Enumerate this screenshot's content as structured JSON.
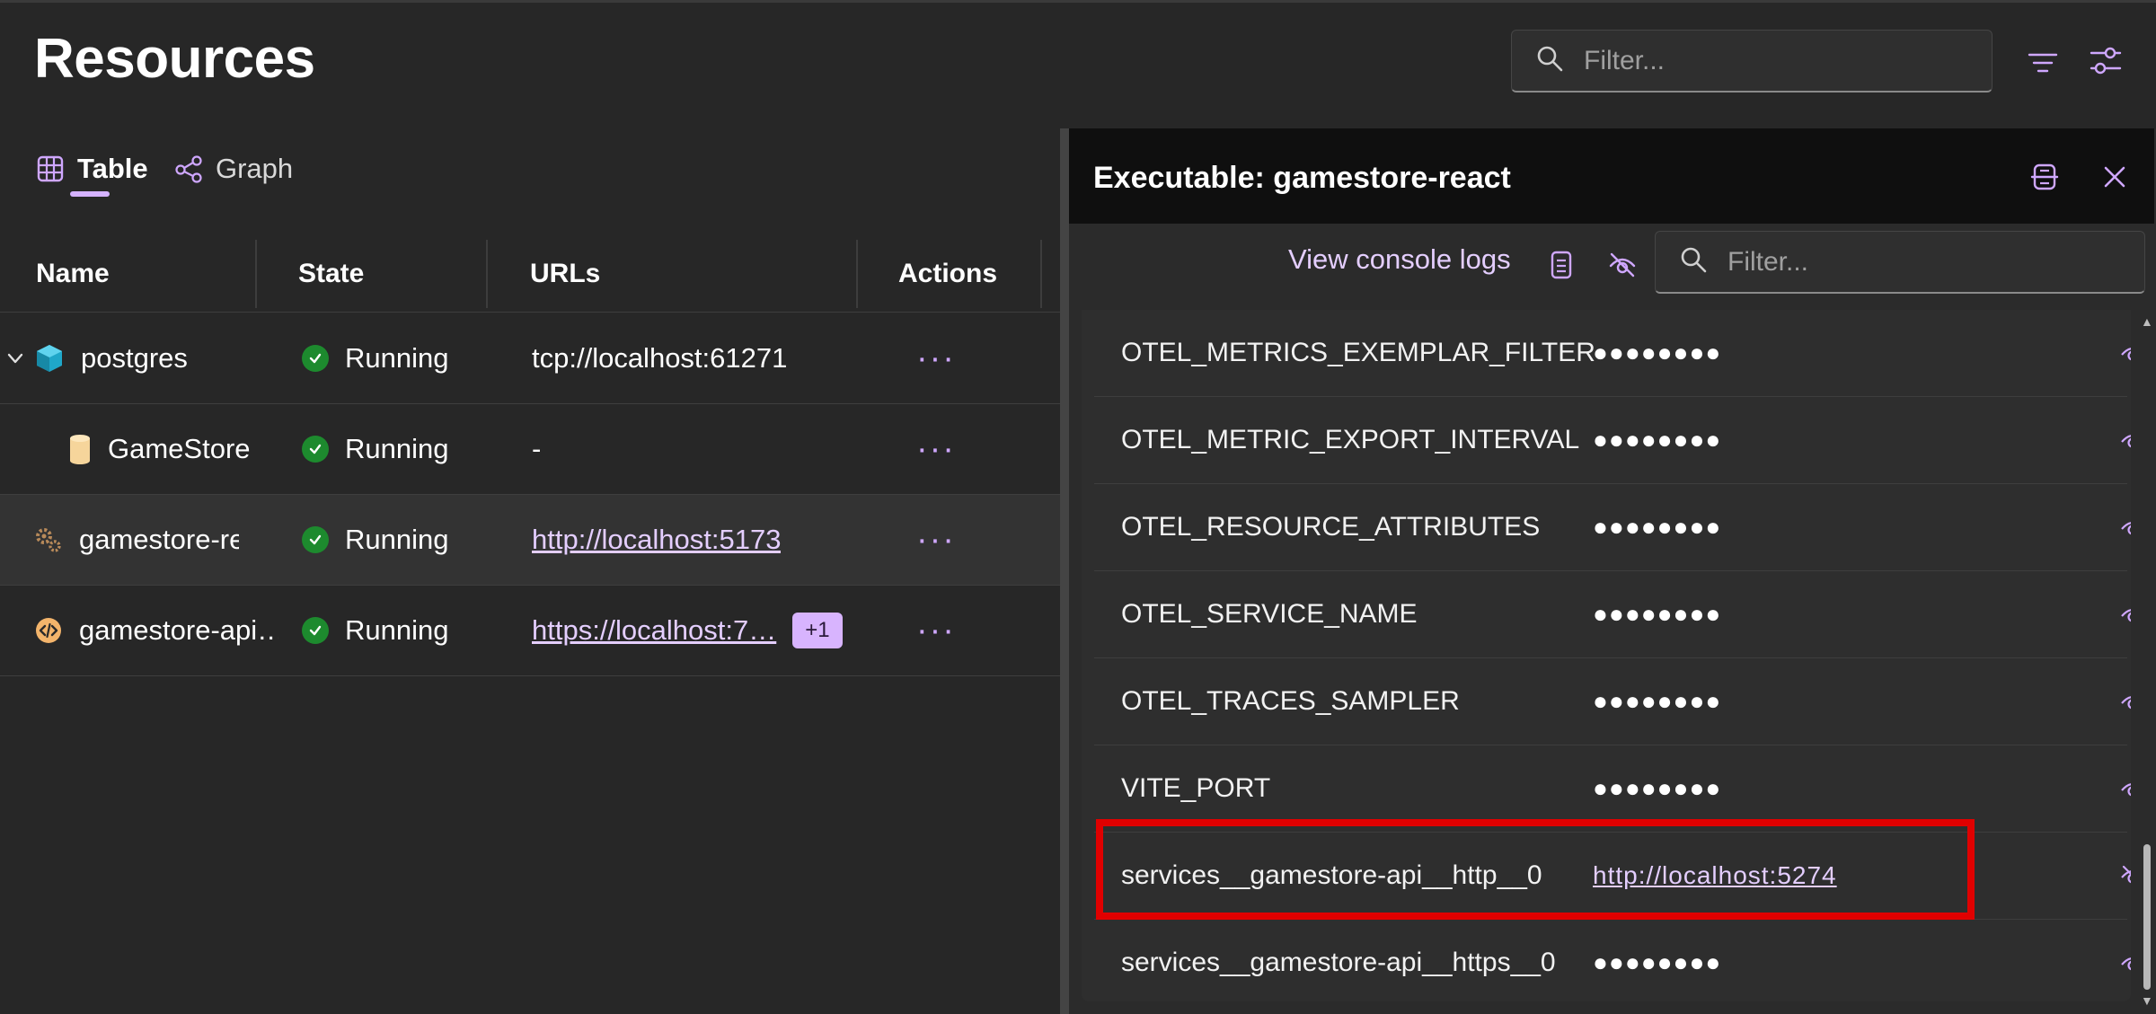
{
  "page": {
    "title": "Resources"
  },
  "search": {
    "placeholder": "Filter..."
  },
  "tabs": [
    {
      "label": "Table",
      "icon": "table-icon",
      "active": true
    },
    {
      "label": "Graph",
      "icon": "graph-icon",
      "active": false
    }
  ],
  "table": {
    "columns": [
      "Name",
      "State",
      "URLs",
      "Actions"
    ],
    "rows": [
      {
        "name": "postgres",
        "icon": "container-icon",
        "expand": "chevron-down-icon",
        "state": "Running",
        "url": "tcp://localhost:61271",
        "url_is_link": false,
        "extra_badge": "",
        "actions": "···"
      },
      {
        "name": "GameStore",
        "icon": "database-icon",
        "state": "Running",
        "url": "-",
        "url_is_link": false,
        "extra_badge": "",
        "actions": "···"
      },
      {
        "name": "gamestore-react",
        "icon": "gears-icon",
        "state": "Running",
        "url": "http://localhost:5173",
        "url_is_link": true,
        "extra_badge": "",
        "actions": "···",
        "selected": true
      },
      {
        "name": "gamestore-api…",
        "icon": "code-icon",
        "state": "Running",
        "url": "https://localhost:7…",
        "url_is_link": true,
        "extra_badge": "+1",
        "actions": "···"
      }
    ]
  },
  "panel": {
    "title": "Executable: gamestore-react",
    "console_link": "View console logs",
    "filter_placeholder": "Filter...",
    "env_vars": [
      {
        "name": "OTEL_METRICS_EXEMPLAR_FILTER",
        "value": "●●●●●●●●",
        "masked": true
      },
      {
        "name": "OTEL_METRIC_EXPORT_INTERVAL",
        "value": "●●●●●●●●",
        "masked": true
      },
      {
        "name": "OTEL_RESOURCE_ATTRIBUTES",
        "value": "●●●●●●●●",
        "masked": true
      },
      {
        "name": "OTEL_SERVICE_NAME",
        "value": "●●●●●●●●",
        "masked": true
      },
      {
        "name": "OTEL_TRACES_SAMPLER",
        "value": "●●●●●●●●",
        "masked": true
      },
      {
        "name": "VITE_PORT",
        "value": "●●●●●●●●",
        "masked": true
      },
      {
        "name": "services__gamestore-api__http__0",
        "value": "http://localhost:5274",
        "masked": false,
        "highlighted": true
      },
      {
        "name": "services__gamestore-api__https__0",
        "value": "●●●●●●●●",
        "masked": true
      }
    ]
  },
  "colors": {
    "accent": "#d8b4fe",
    "link": "#e4ceff",
    "success": "#1d8a2e",
    "highlight": "#e00000"
  }
}
